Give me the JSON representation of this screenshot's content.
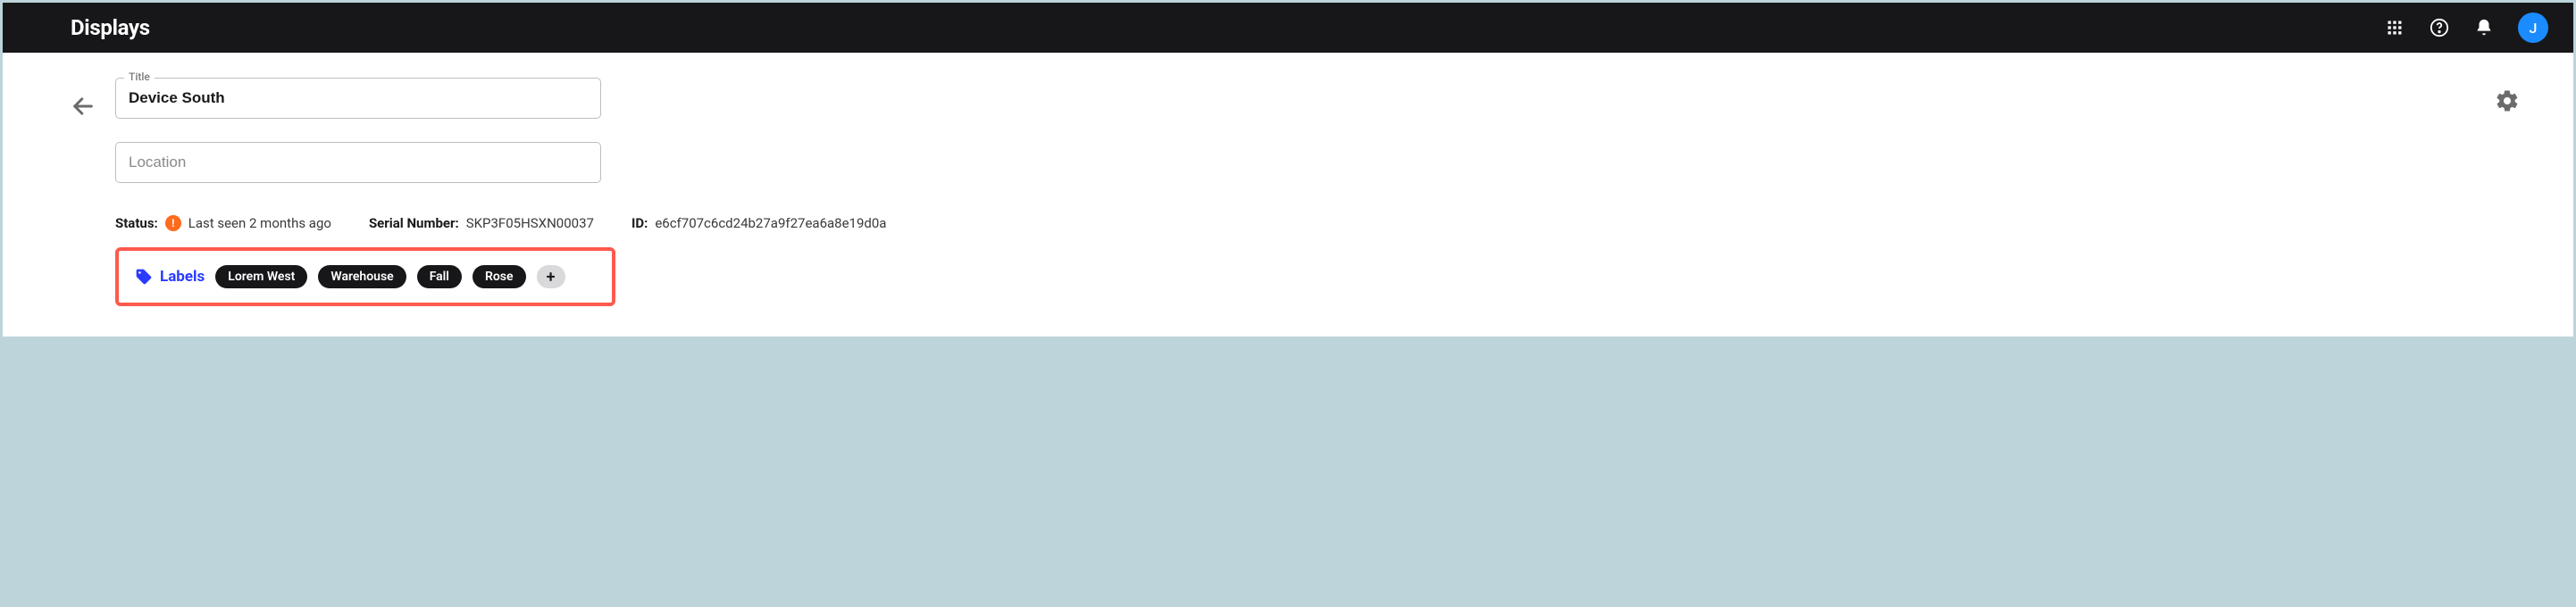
{
  "header": {
    "title": "Displays",
    "avatar_initial": "J"
  },
  "form": {
    "title_label": "Title",
    "title_value": "Device South",
    "location_placeholder": "Location",
    "location_value": ""
  },
  "meta": {
    "status_label": "Status:",
    "status_value": "Last seen 2 months ago",
    "serial_label": "Serial Number:",
    "serial_value": "SKP3F05HSXN00037",
    "id_label": "ID:",
    "id_value": "e6cf707c6cd24b27a9f27ea6a8e19d0a"
  },
  "labels": {
    "heading": "Labels",
    "items": [
      "Lorem West",
      "Warehouse",
      "Fall",
      "Rose"
    ],
    "add_glyph": "+"
  }
}
